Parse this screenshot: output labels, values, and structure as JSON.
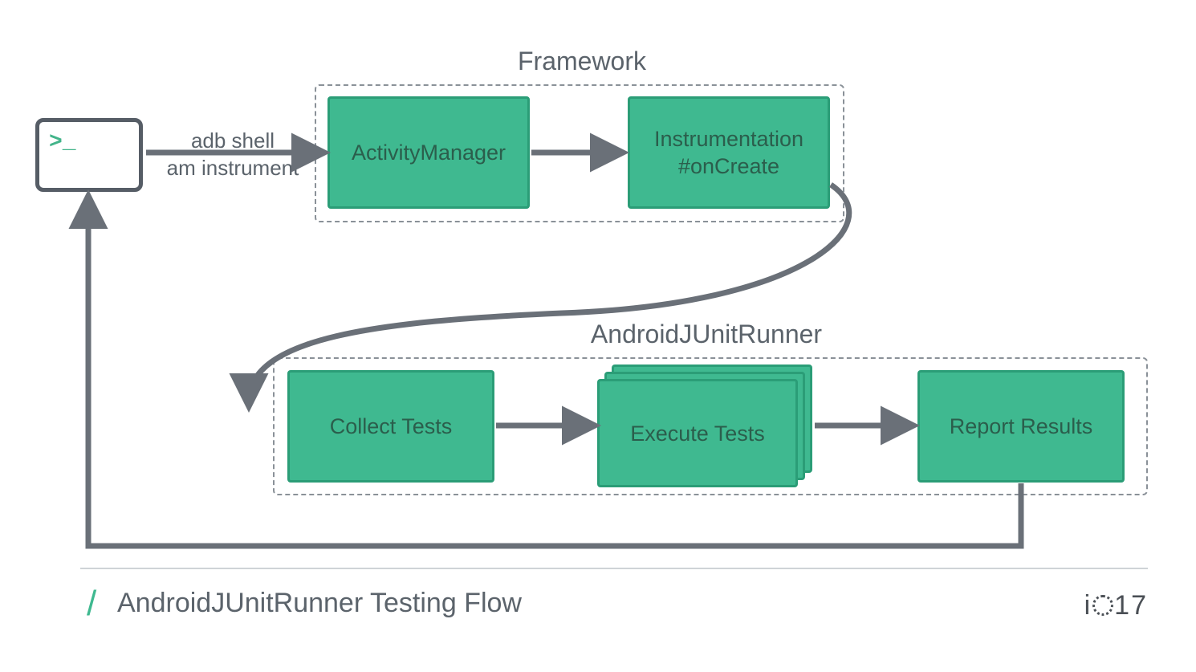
{
  "terminal": {
    "prompt": ">_"
  },
  "adb_label": {
    "line1": "adb shell",
    "line2": "am instrument"
  },
  "framework": {
    "title": "Framework",
    "nodes": {
      "activity_manager": "ActivityManager",
      "instrumentation_line1": "Instrumentation",
      "instrumentation_line2": "#onCreate"
    }
  },
  "runner": {
    "title": "AndroidJUnitRunner",
    "nodes": {
      "collect": "Collect Tests",
      "execute": "Execute Tests",
      "report": "Report Results"
    }
  },
  "footer": {
    "title": "AndroidJUnitRunner Testing Flow",
    "logo_left": "i",
    "logo_right": "17"
  },
  "colors": {
    "node_fill": "#3fb990",
    "node_border": "#2b9d77",
    "arrow": "#6a7078",
    "text": "#5b636b"
  }
}
